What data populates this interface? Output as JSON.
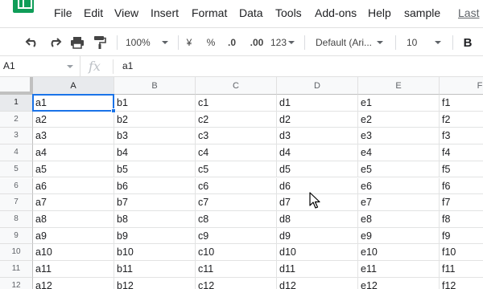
{
  "menu": {
    "items": [
      "File",
      "Edit",
      "View",
      "Insert",
      "Format",
      "Data",
      "Tools",
      "Add-ons",
      "Help"
    ],
    "doc_title": "sample",
    "last_edit": "Last"
  },
  "toolbar": {
    "zoom": "100%",
    "currency": "¥",
    "percent": "%",
    "dec_less": ".0",
    "dec_more": ".00",
    "more_formats": "123",
    "font": "Default (Ari...",
    "font_size": "10",
    "bold": "B"
  },
  "formula_bar": {
    "name_box": "A1",
    "fx": "fx",
    "value": "a1"
  },
  "sheet": {
    "columns": [
      "A",
      "B",
      "C",
      "D",
      "E",
      "F"
    ],
    "rows": [
      "1",
      "2",
      "3",
      "4",
      "5",
      "6",
      "7",
      "8",
      "9",
      "10",
      "11",
      "12"
    ],
    "cells": [
      [
        "a1",
        "b1",
        "c1",
        "d1",
        "e1",
        "f1"
      ],
      [
        "a2",
        "b2",
        "c2",
        "d2",
        "e2",
        "f2"
      ],
      [
        "a3",
        "b3",
        "c3",
        "d3",
        "e3",
        "f3"
      ],
      [
        "a4",
        "b4",
        "c4",
        "d4",
        "e4",
        "f4"
      ],
      [
        "a5",
        "b5",
        "c5",
        "d5",
        "e5",
        "f5"
      ],
      [
        "a6",
        "b6",
        "c6",
        "d6",
        "e6",
        "f6"
      ],
      [
        "a7",
        "b7",
        "c7",
        "d7",
        "e7",
        "f7"
      ],
      [
        "a8",
        "b8",
        "c8",
        "d8",
        "e8",
        "f8"
      ],
      [
        "a9",
        "b9",
        "c9",
        "d9",
        "e9",
        "f9"
      ],
      [
        "a10",
        "b10",
        "c10",
        "d10",
        "e10",
        "f10"
      ],
      [
        "a11",
        "b11",
        "c11",
        "d11",
        "e11",
        "f11"
      ],
      [
        "a12",
        "b12",
        "c12",
        "d12",
        "e12",
        "f12"
      ]
    ],
    "active_cell": "A1"
  },
  "colors": {
    "accent": "#1a73e8",
    "brand": "#0f9d58"
  }
}
